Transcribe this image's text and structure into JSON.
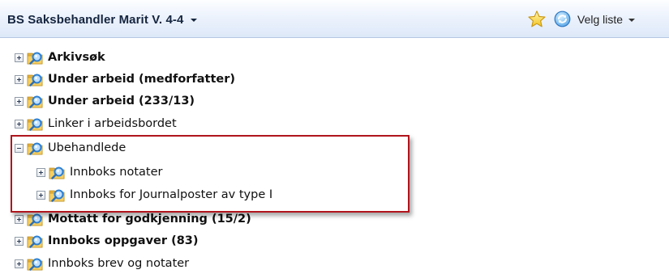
{
  "header": {
    "title": "BS Saksbehandler Marit V.  4-4",
    "favorite_icon": "star-icon",
    "refresh_icon": "refresh-icon",
    "list_selector_label": "Velg liste"
  },
  "tree": {
    "items": [
      {
        "label": "Arkivsøk",
        "bold": true,
        "expanded": false
      },
      {
        "label": "Under arbeid (medforfatter)",
        "bold": true,
        "expanded": false
      },
      {
        "label": "Under arbeid (233/13)",
        "bold": true,
        "expanded": false
      },
      {
        "label": "Linker i arbeidsbordet",
        "bold": false,
        "expanded": false
      },
      {
        "label": "Ubehandlede",
        "bold": false,
        "expanded": true,
        "children": [
          {
            "label": "Innboks notater",
            "bold": false,
            "expanded": false
          },
          {
            "label": "Innboks for Journalposter av type I",
            "bold": false,
            "expanded": false
          }
        ]
      },
      {
        "label": "Mottatt for godkjenning (15/2)",
        "bold": true,
        "expanded": false
      },
      {
        "label": "Innboks oppgaver (83)",
        "bold": true,
        "expanded": false
      },
      {
        "label": "Innboks brev og notater",
        "bold": false,
        "expanded": false
      }
    ]
  },
  "colors": {
    "highlight_border": "#b0151d",
    "folder": "#f3c34e",
    "magnifier": "#3b8fd9"
  }
}
